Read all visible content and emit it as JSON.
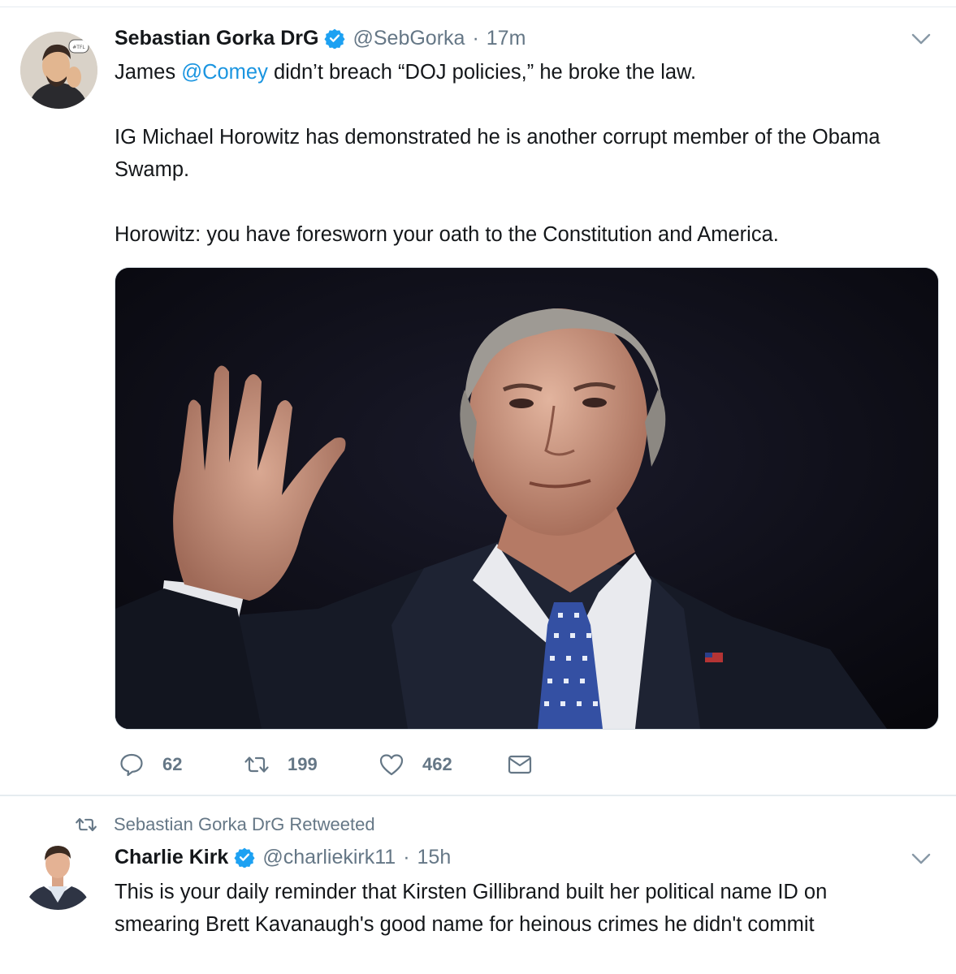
{
  "tweet1": {
    "author_name": "Sebastian Gorka DrG",
    "handle": "@SebGorka",
    "separator": "·",
    "time": "17m",
    "text_line1_pre": "James ",
    "text_line1_mention": "@Comey",
    "text_line1_post": " didn’t breach “DOJ policies,” he broke the law.",
    "text_para2": "IG Michael Horowitz has demonstrated he is another corrupt member of the Obama Swamp.",
    "text_para3": "Horowitz: you have foresworn your oath to the Constitution and America.",
    "replies": "62",
    "retweets": "199",
    "likes": "462"
  },
  "tweet2": {
    "retweeted_by": "Sebastian Gorka DrG Retweeted",
    "author_name": "Charlie Kirk",
    "handle": "@charliekirk11",
    "separator": "·",
    "time": "15h",
    "text": "This is your daily reminder that Kirsten Gillibrand built her political name ID on smearing Brett Kavanaugh's good name for heinous crimes he didn't commit"
  },
  "colors": {
    "link": "#1b95e0",
    "secondary_text": "#657786",
    "verified": "#1da1f2",
    "divider": "#e6ecf0"
  },
  "icons": {
    "reply": "speech-bubble-icon",
    "retweet": "retweet-arrows-icon",
    "like": "heart-icon",
    "dm": "envelope-icon",
    "verified": "verified-check-icon",
    "caret": "chevron-down-icon"
  }
}
